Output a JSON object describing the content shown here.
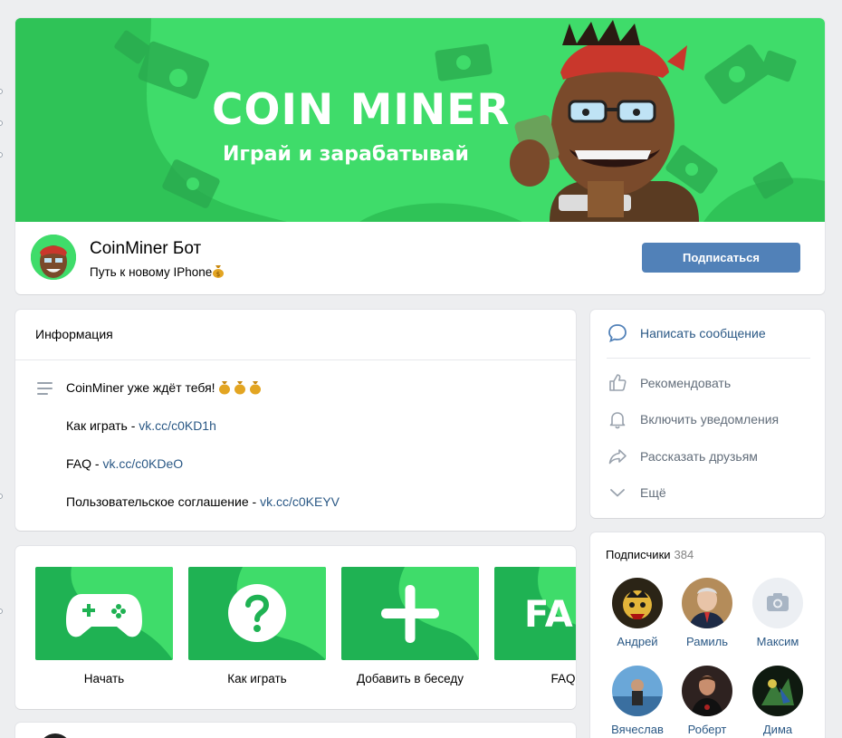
{
  "header": {
    "cover_title": "COIN MINER",
    "cover_subtitle": "Играй и зарабатывай",
    "group_name": "CoinMiner Бот",
    "group_status": "Путь к новому IPhone",
    "subscribe_label": "Подписаться"
  },
  "info": {
    "title": "Информация",
    "description": "CoinMiner уже ждёт тебя!",
    "lines": [
      {
        "label": "Как играть - ",
        "link": "vk.cc/c0KD1h"
      },
      {
        "label": "FAQ - ",
        "link": "vk.cc/c0KDeO"
      },
      {
        "label": "Пользовательское соглашение - ",
        "link": "vk.cc/c0KEYV"
      }
    ]
  },
  "apps": [
    {
      "label": "Начать",
      "icon": "gamepad-icon"
    },
    {
      "label": "Как играть",
      "icon": "question-icon"
    },
    {
      "label": "Добавить в беседу",
      "icon": "plus-icon"
    },
    {
      "label": "FAQ",
      "icon": "faq-icon",
      "tile_text": "FA"
    }
  ],
  "actions": [
    {
      "label": "Написать сообщение",
      "icon": "message-icon"
    },
    {
      "label": "Рекомендовать",
      "icon": "thumbs-up-icon"
    },
    {
      "label": "Включить уведомления",
      "icon": "bell-icon"
    },
    {
      "label": "Рассказать друзьям",
      "icon": "share-icon"
    },
    {
      "label": "Ещё",
      "icon": "chevron-down-icon"
    }
  ],
  "subscribers": {
    "title": "Подписчики",
    "count": "384",
    "people": [
      {
        "name": "Андрей"
      },
      {
        "name": "Рамиль"
      },
      {
        "name": "Максим"
      },
      {
        "name": "Вячеслав"
      },
      {
        "name": "Роберт"
      },
      {
        "name": "Дима"
      }
    ]
  },
  "colors": {
    "accent": "#5181b8",
    "link": "#2a5885",
    "cover_green": "#3fdc6a",
    "tile_green": "#1fb253",
    "page_bg": "#edeef0"
  }
}
